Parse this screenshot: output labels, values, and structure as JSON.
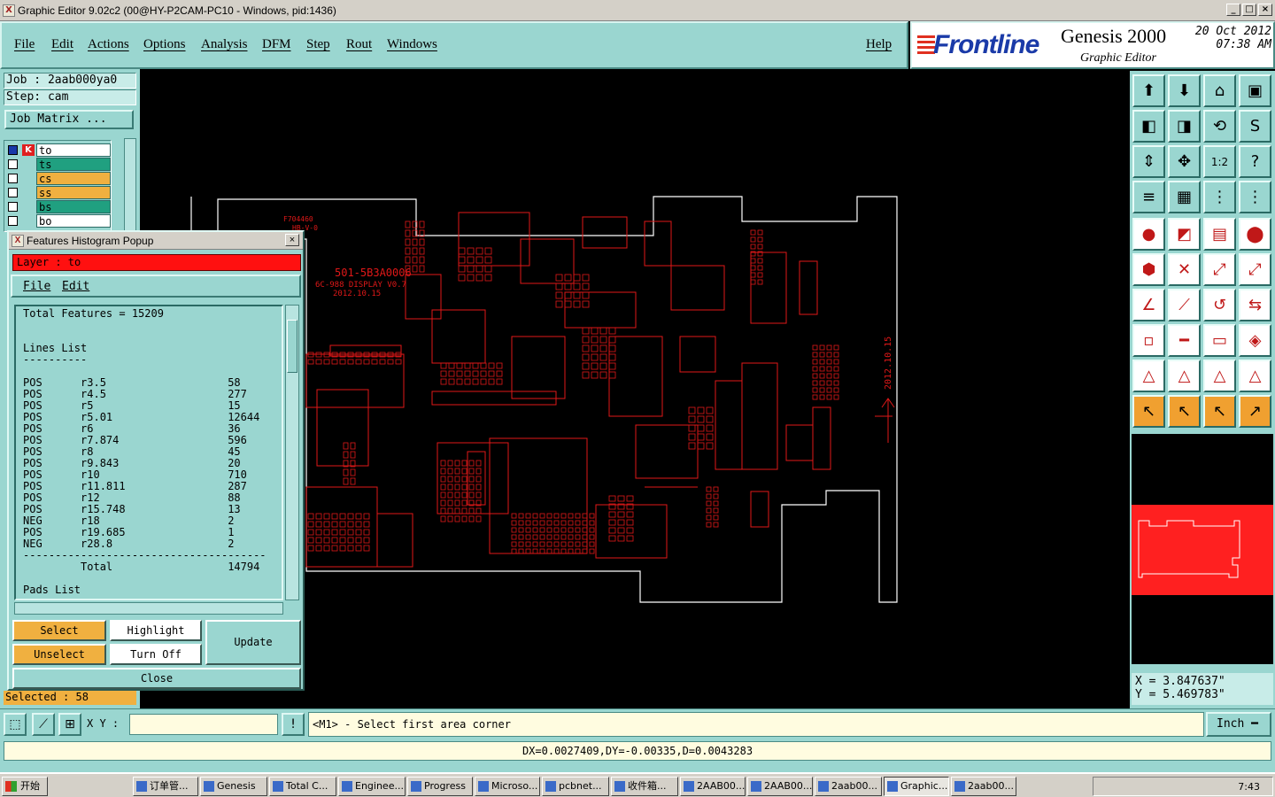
{
  "window": {
    "title": "Graphic Editor 9.02c2 (00@HY-P2CAM-PC10 - Windows, pid:1436)"
  },
  "menu": {
    "items": [
      "File",
      "Edit",
      "Actions",
      "Options",
      "Analysis",
      "DFM",
      "Step",
      "Rout",
      "Windows"
    ],
    "help": "Help"
  },
  "branding": {
    "logo": "Frontline",
    "product": "Genesis 2000",
    "subtitle": "Graphic Editor",
    "date": "20 Oct 2012",
    "time": "07:38 AM"
  },
  "job": {
    "job_line": "Job : 2aab000ya0",
    "step_line": "Step: cam",
    "matrix_button": "Job Matrix ..."
  },
  "layers": [
    {
      "name": "to",
      "color": "#ffffff",
      "checked": true
    },
    {
      "name": "ts",
      "color": "#20a080",
      "checked": false
    },
    {
      "name": "cs",
      "color": "#f0b040",
      "checked": false
    },
    {
      "name": "ss",
      "color": "#f0b040",
      "checked": false
    },
    {
      "name": "bs",
      "color": "#20a080",
      "checked": false
    },
    {
      "name": "bo",
      "color": "#ffffff",
      "checked": false
    }
  ],
  "popup": {
    "title": "Features Histogram Popup",
    "layer_label": "Layer :  to",
    "menu": [
      "File",
      "Edit"
    ],
    "total_features": "Total Features = 15209",
    "lines_header": "Lines List",
    "rows": [
      {
        "pol": "POS",
        "sym": "r3.5",
        "count": "58"
      },
      {
        "pol": "POS",
        "sym": "r4.5",
        "count": "277"
      },
      {
        "pol": "POS",
        "sym": "r5",
        "count": "15"
      },
      {
        "pol": "POS",
        "sym": "r5.01",
        "count": "12644"
      },
      {
        "pol": "POS",
        "sym": "r6",
        "count": "36"
      },
      {
        "pol": "POS",
        "sym": "r7.874",
        "count": "596"
      },
      {
        "pol": "POS",
        "sym": "r8",
        "count": "45"
      },
      {
        "pol": "POS",
        "sym": "r9.843",
        "count": "20"
      },
      {
        "pol": "POS",
        "sym": "r10",
        "count": "710"
      },
      {
        "pol": "POS",
        "sym": "r11.811",
        "count": "287"
      },
      {
        "pol": "POS",
        "sym": "r12",
        "count": "88"
      },
      {
        "pol": "POS",
        "sym": "r15.748",
        "count": "13"
      },
      {
        "pol": "NEG",
        "sym": "r18",
        "count": "2"
      },
      {
        "pol": "POS",
        "sym": "r19.685",
        "count": "1"
      },
      {
        "pol": "NEG",
        "sym": "r28.8",
        "count": "2"
      }
    ],
    "total_label": "Total",
    "total_value": "14794",
    "pads_header": "Pads List",
    "buttons": {
      "select": "Select",
      "unselect": "Unselect",
      "highlight": "Highlight",
      "turn_off": "Turn Off",
      "update": "Update",
      "close": "Close"
    }
  },
  "selected": "Selected : 58",
  "pcb_text": {
    "part": "501-5B3A0006",
    "name": "6C-988 DISPLAY V0.7",
    "date": "2012.10.15",
    "side_date": "2012.10.15",
    "top_label": "F704460",
    "sub_label": "HB-V-0"
  },
  "coords": {
    "x": "X = 3.847637\"",
    "y": "Y = 5.469783\""
  },
  "command": {
    "xy_label": "X Y :",
    "xy_value": "",
    "prompt": "<M1> - Select first area corner",
    "unit": "Inch"
  },
  "status": "DX=0.0027409,DY=-0.00335,D=0.0043283",
  "taskbar": {
    "start": "开始",
    "tasks": [
      "订单管...",
      "Genesis",
      "Total C...",
      "Enginee...",
      "Progress",
      "Microso...",
      "pcbnet...",
      "收件箱...",
      "2AAB00...",
      "2AAB00...",
      "2aab00...",
      "Graphic...",
      "2aab00..."
    ],
    "active_index": 11,
    "clock": "7:43"
  }
}
